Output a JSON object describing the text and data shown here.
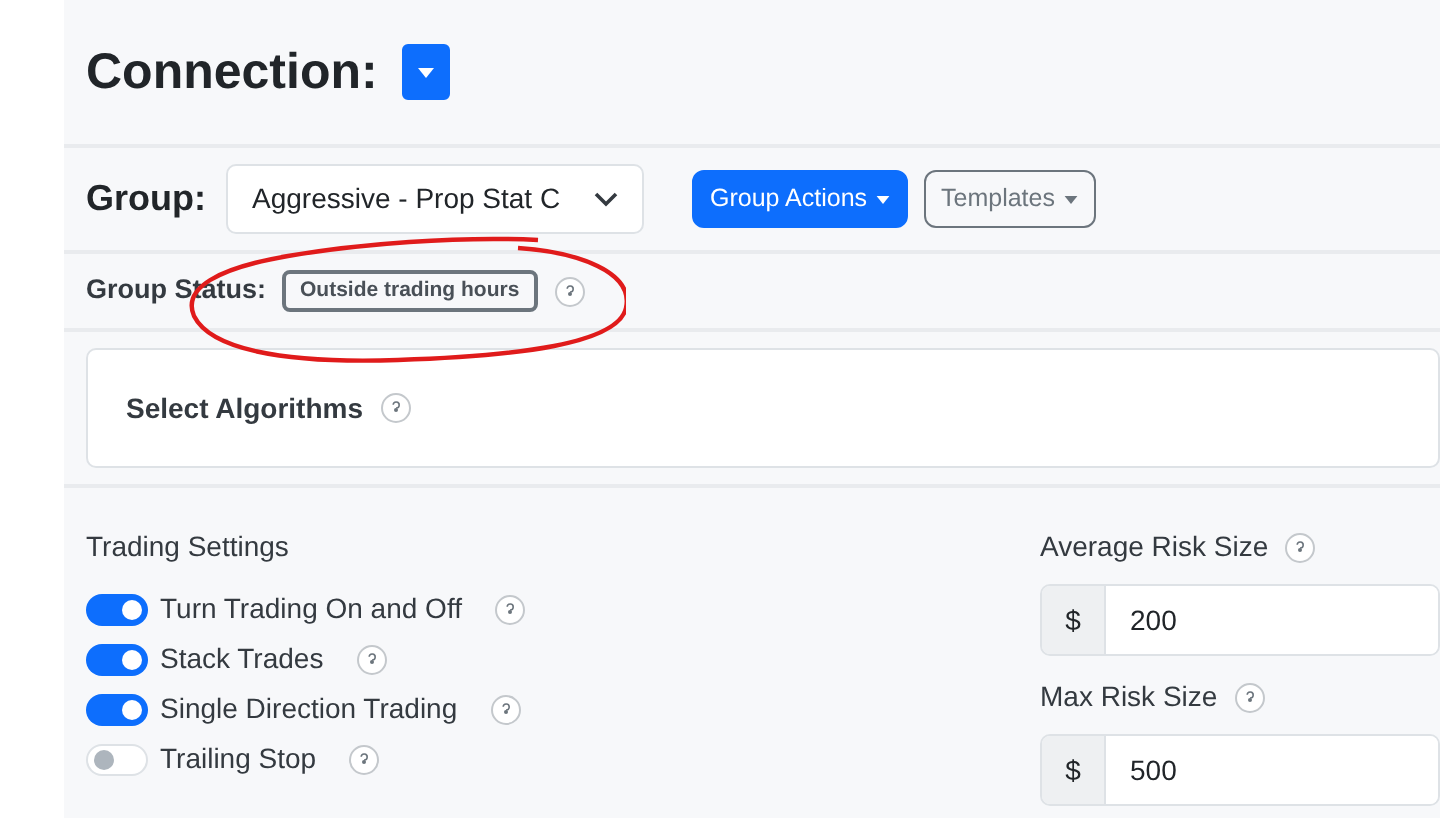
{
  "header": {
    "title": "Connection:"
  },
  "group": {
    "label": "Group:",
    "value": "Aggressive - Prop Stat C",
    "actions": [
      {
        "label": "Group Actions",
        "kind": "primary"
      },
      {
        "label": "Templates",
        "kind": "outline"
      }
    ]
  },
  "group_status": {
    "label": "Group Status:",
    "badge": "Outside trading hours"
  },
  "algorithms": {
    "title": "Select Algorithms"
  },
  "trading_settings": {
    "title": "Trading Settings",
    "switches": [
      {
        "label": "Turn Trading On and Off",
        "on": true
      },
      {
        "label": "Stack Trades",
        "on": true
      },
      {
        "label": "Single Direction Trading",
        "on": true
      },
      {
        "label": "Trailing Stop",
        "on": false
      }
    ]
  },
  "risk_fields": [
    {
      "label": "Average Risk Size",
      "prefix": "$",
      "value": "200"
    },
    {
      "label": "Max Risk Size",
      "prefix": "$",
      "value": "500"
    }
  ]
}
